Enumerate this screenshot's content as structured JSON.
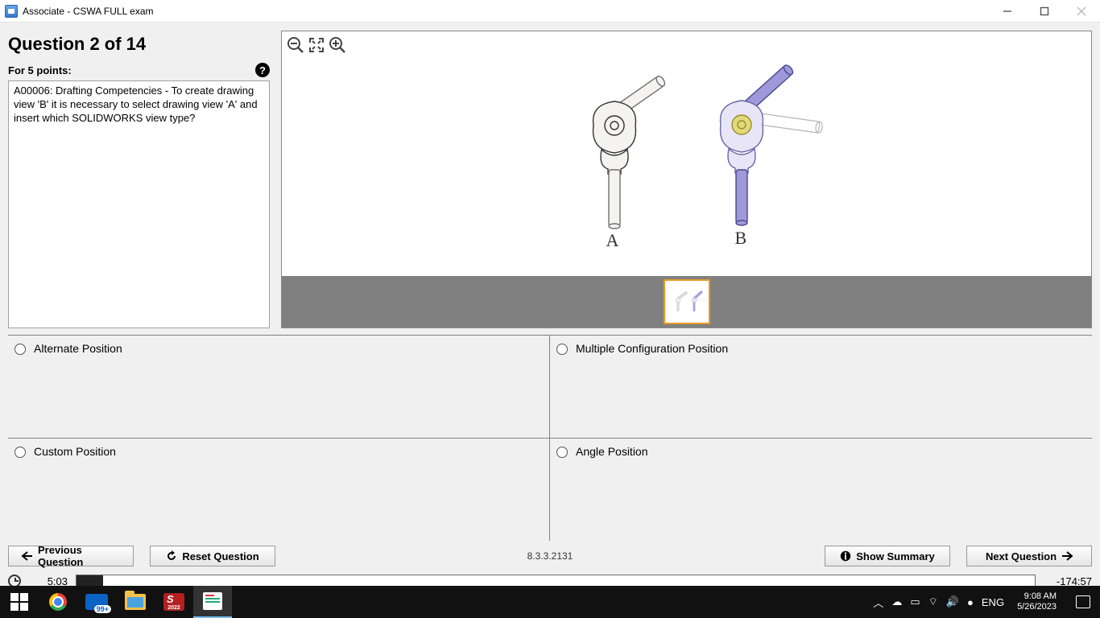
{
  "window": {
    "title": "Associate - CSWA FULL exam"
  },
  "question": {
    "header": "Question 2 of 14",
    "points_label": "For 5 points:",
    "text": "A00006:  Drafting Competencies - To create drawing view 'B' it is necessary to select drawing view 'A' and insert which SOLIDWORKS view type?",
    "labels": {
      "a": "A",
      "b": "B"
    }
  },
  "answers": [
    {
      "id": "alternate",
      "label": "Alternate Position"
    },
    {
      "id": "multiple-config",
      "label": "Multiple Configuration Position"
    },
    {
      "id": "custom",
      "label": "Custom Position"
    },
    {
      "id": "angle",
      "label": "Angle Position"
    }
  ],
  "nav": {
    "prev": "Previous Question",
    "reset": "Reset Question",
    "summary": "Show Summary",
    "next": "Next Question",
    "version": "8.3.3.2131"
  },
  "timer": {
    "elapsed": "5:03",
    "remaining": "-174:57",
    "progress_pct": 2.8
  },
  "taskbar": {
    "mail_badge": "99+",
    "sw_year": "2022",
    "lang": "ENG",
    "time": "9:08 AM",
    "date": "5/26/2023"
  }
}
